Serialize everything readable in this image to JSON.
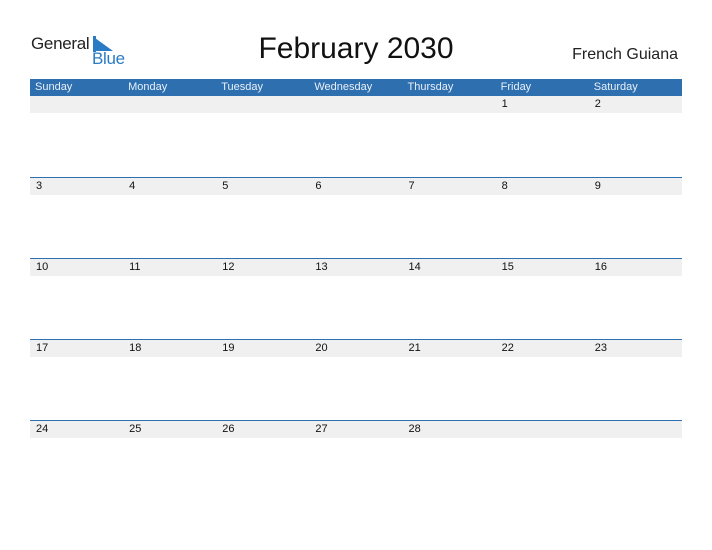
{
  "brand": {
    "line1": "General",
    "line2": "Blue",
    "accent": "#2a7bc4"
  },
  "header": {
    "title": "February 2030",
    "region": "French Guiana"
  },
  "colors": {
    "header_bg": "#2e6fb0",
    "strip_bg": "#f0f0f0"
  },
  "weekdays": [
    "Sunday",
    "Monday",
    "Tuesday",
    "Wednesday",
    "Thursday",
    "Friday",
    "Saturday"
  ],
  "weeks": [
    [
      "",
      "",
      "",
      "",
      "",
      "1",
      "2"
    ],
    [
      "3",
      "4",
      "5",
      "6",
      "7",
      "8",
      "9"
    ],
    [
      "10",
      "11",
      "12",
      "13",
      "14",
      "15",
      "16"
    ],
    [
      "17",
      "18",
      "19",
      "20",
      "21",
      "22",
      "23"
    ],
    [
      "24",
      "25",
      "26",
      "27",
      "28",
      "",
      ""
    ]
  ]
}
